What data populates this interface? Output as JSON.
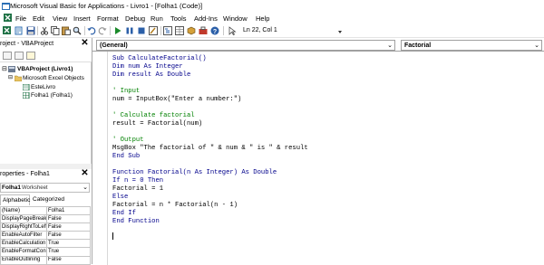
{
  "window": {
    "title": "Microsoft Visual Basic for Applications - Livro1 - [Folha1 (Code)]"
  },
  "menubar": {
    "items": [
      {
        "id": "file",
        "label": "File"
      },
      {
        "id": "edit",
        "label": "Edit"
      },
      {
        "id": "view",
        "label": "View"
      },
      {
        "id": "insert",
        "label": "Insert"
      },
      {
        "id": "format",
        "label": "Format"
      },
      {
        "id": "debug",
        "label": "Debug"
      },
      {
        "id": "run",
        "label": "Run"
      },
      {
        "id": "tools",
        "label": "Tools"
      },
      {
        "id": "addins",
        "label": "Add-Ins"
      },
      {
        "id": "window",
        "label": "Window"
      },
      {
        "id": "help",
        "label": "Help"
      }
    ]
  },
  "toolbar": {
    "position_label": "Ln 22, Col 1",
    "icons": [
      "excel-icon",
      "insert-module-icon",
      "save-icon",
      "cut-icon",
      "copy-icon",
      "paste-icon",
      "find-icon",
      "undo-icon",
      "redo-icon",
      "run-icon",
      "break-icon",
      "reset-icon",
      "design-mode-icon",
      "project-explorer-icon",
      "properties-window-icon",
      "object-browser-icon",
      "toolbox-icon",
      "help-icon"
    ]
  },
  "project_pane": {
    "title": "roject - VBAProject",
    "tree": {
      "project": "VBAProject (Livro1)",
      "folder": "Microsoft Excel Objects",
      "items": [
        "EsteLivro",
        "Folha1 (Folha1)"
      ]
    }
  },
  "properties_pane": {
    "title": "roperties - Folha1",
    "object_name": "Folha1",
    "object_type": "Worksheet",
    "tabs": [
      "Alphabetic",
      "Categorized"
    ],
    "rows": [
      {
        "name": "(Name)",
        "value": "Folha1"
      },
      {
        "name": "DisplayPageBreaks",
        "value": "False"
      },
      {
        "name": "DisplayRightToLeft",
        "value": "False"
      },
      {
        "name": "EnableAutoFilter",
        "value": "False"
      },
      {
        "name": "EnableCalculation",
        "value": "True"
      },
      {
        "name": "EnableFormatConditions",
        "value": "True"
      },
      {
        "name": "EnableOutlining",
        "value": "False"
      }
    ]
  },
  "code_window": {
    "object_combo": "(General)",
    "procedure_combo": "Factorial",
    "lines": [
      "Sub CalculateFactorial()",
      "Dim num As Integer",
      "Dim result As Double",
      "",
      "' Input",
      "num = InputBox(\"Enter a number:\")",
      "",
      "' Calculate factorial",
      "result = Factorial(num)",
      "",
      "' Output",
      "MsgBox \"The factorial of \" & num & \" is \" & result",
      "End Sub",
      "",
      "Function Factorial(n As Integer) As Double",
      "If n = 0 Then",
      "Factorial = 1",
      "Else",
      "Factorial = n * Factorial(n - 1)",
      "End If",
      "End Function"
    ]
  }
}
